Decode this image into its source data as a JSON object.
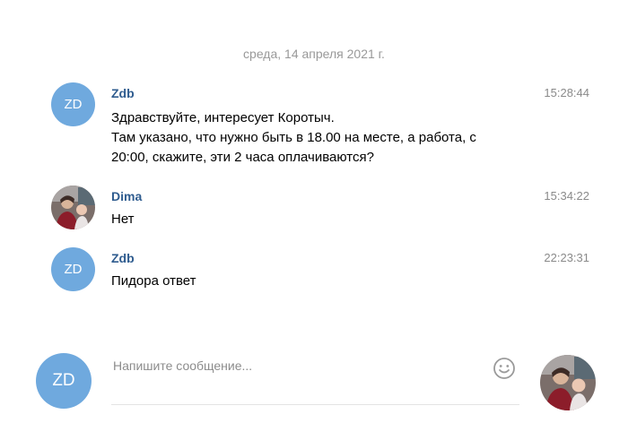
{
  "date_separator": "среда, 14 апреля 2021 г.",
  "messages": [
    {
      "author": "Zdb",
      "avatar_initials": "ZD",
      "time": "15:28:44",
      "lines": [
        "Здравствуйте, интересует Коротыч.",
        "Там указано, что нужно быть в 18.00 на месте, а работа, с",
        "20:00, скажите, эти 2 часа оплачиваются?"
      ]
    },
    {
      "author": "Dima",
      "time": "15:34:22",
      "lines": [
        "Нет"
      ]
    },
    {
      "author": "Zdb",
      "avatar_initials": "ZD",
      "time": "22:23:31",
      "lines": [
        "Пидора ответ"
      ]
    }
  ],
  "composer": {
    "avatar_initials": "ZD",
    "placeholder": "Напишите сообщение...",
    "emoji_icon": "smile-icon"
  },
  "colors": {
    "avatar_bg": "#6fa9de",
    "author_name": "#2f5c8f",
    "muted": "#8a8a8a"
  }
}
